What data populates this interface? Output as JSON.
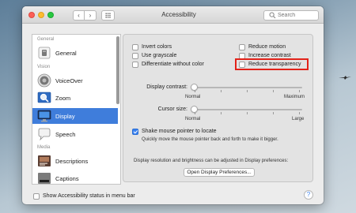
{
  "window": {
    "title": "Accessibility"
  },
  "toolbar": {
    "back_glyph": "‹",
    "forward_glyph": "›",
    "search_placeholder": "Search"
  },
  "sidebar": {
    "sections": [
      {
        "header": "General"
      },
      {
        "header": "Vision"
      },
      {
        "header": "Media"
      }
    ],
    "items": [
      {
        "label": "General",
        "icon": "general-icon"
      },
      {
        "label": "VoiceOver",
        "icon": "voiceover-icon"
      },
      {
        "label": "Zoom",
        "icon": "zoom-icon"
      },
      {
        "label": "Display",
        "icon": "display-icon",
        "selected": true
      },
      {
        "label": "Speech",
        "icon": "speech-icon"
      },
      {
        "label": "Descriptions",
        "icon": "descriptions-icon"
      },
      {
        "label": "Captions",
        "icon": "captions-icon"
      }
    ]
  },
  "display": {
    "options_left": [
      {
        "label": "Invert colors",
        "checked": false
      },
      {
        "label": "Use grayscale",
        "checked": false
      },
      {
        "label": "Differentiate without color",
        "checked": false
      }
    ],
    "options_right": [
      {
        "label": "Reduce motion",
        "checked": false
      },
      {
        "label": "Increase contrast",
        "checked": false
      },
      {
        "label": "Reduce transparency",
        "checked": false
      }
    ],
    "contrast": {
      "label": "Display contrast:",
      "min_label": "Normal",
      "max_label": "Maximum",
      "value": 0
    },
    "cursor": {
      "label": "Cursor size:",
      "min_label": "Normal",
      "max_label": "Large",
      "value": 0
    },
    "shake": {
      "label": "Shake mouse pointer to locate",
      "checked": true,
      "hint": "Quickly move the mouse pointer back and forth to make it bigger."
    },
    "resolution_note": "Display resolution and brightness can be adjusted in Display preferences:",
    "open_button": "Open Display Preferences..."
  },
  "footer": {
    "status_label": "Show Accessibility status in menu bar",
    "status_checked": false,
    "help_glyph": "?"
  },
  "colors": {
    "selection": "#3f7ddb",
    "checkbox_checked": "#3b82f0",
    "highlight": "#e2231a"
  }
}
